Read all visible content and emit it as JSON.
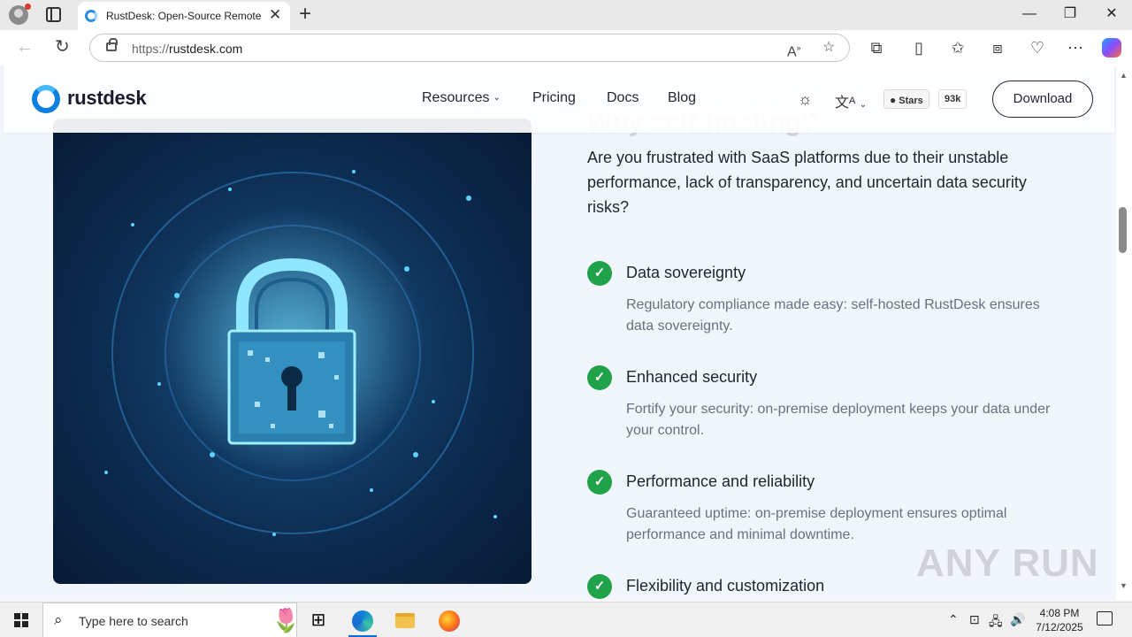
{
  "browser": {
    "tab_title": "RustDesk: Open-Source Remote D",
    "url_scheme": "https://",
    "url_host": "rustdesk.com",
    "icons": [
      "profile-icon",
      "tab-actions-icon",
      "close-icon",
      "new-tab-icon",
      "minimize-icon",
      "restore-icon",
      "window-close-icon",
      "back-icon",
      "refresh-icon",
      "read-aloud-icon",
      "favorite-icon",
      "extensions-icon",
      "split-screen-icon",
      "favorites-icon",
      "collections-icon",
      "browser-essentials-icon",
      "more-icon",
      "copilot-icon"
    ]
  },
  "site": {
    "logo_text": "rustdesk",
    "nav": {
      "resources": "Resources",
      "pricing": "Pricing",
      "docs": "Docs",
      "blog": "Blog"
    },
    "github": {
      "label": "Stars",
      "count": "93k"
    },
    "download_label": "Download"
  },
  "section": {
    "title": "Why self-hosting?",
    "intro": "Are you frustrated with SaaS platforms due to their unstable performance, lack of transparency, and uncertain data security risks?",
    "features": [
      {
        "title": "Data sovereignty",
        "desc": "Regulatory compliance made easy: self-hosted RustDesk ensures data sovereignty."
      },
      {
        "title": "Enhanced security",
        "desc": "Fortify your security: on-premise deployment keeps your data under your control."
      },
      {
        "title": "Performance and reliability",
        "desc": "Guaranteed uptime: on-premise deployment ensures optimal performance and minimal downtime."
      },
      {
        "title": "Flexibility and customization",
        "desc": ""
      }
    ]
  },
  "watermark": "ANY RUN",
  "taskbar": {
    "search_placeholder": "Type here to search",
    "time": "4:08 PM",
    "date": "7/12/2025"
  },
  "colors": {
    "accent": "#0c7fe0",
    "check_green": "#1fa24a",
    "text_dark": "#1f2430",
    "text_muted": "#6b7080"
  }
}
